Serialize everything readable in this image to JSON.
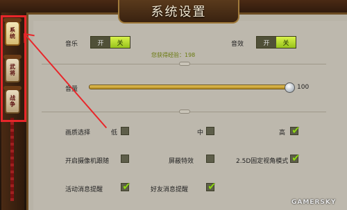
{
  "header": {
    "title": "系统设置"
  },
  "tabs": [
    {
      "label": "系统",
      "active": true
    },
    {
      "label": "武将",
      "active": false
    },
    {
      "label": "战争",
      "active": false
    }
  ],
  "audio": {
    "music_label": "音乐",
    "music_on": "开",
    "music_off": "关",
    "sfx_label": "音效",
    "sfx_on": "开",
    "sfx_off": "关"
  },
  "exp_text": "您获得经验：198",
  "volume": {
    "label": "音量",
    "value": "100",
    "level": 100
  },
  "quality": {
    "label": "画质选择",
    "low": "低",
    "mid": "中",
    "high": "高"
  },
  "options": {
    "camera_follow": "开启摄像机跟随",
    "mask_effect": "屏蔽特效",
    "fixed_angle": "2.5D固定视角模式",
    "activity_notice": "活动消息提醒",
    "friend_notice": "好友消息提醒"
  },
  "checked": {
    "quality_low": false,
    "quality_mid": false,
    "quality_high": true,
    "camera_follow": false,
    "mask_effect": false,
    "fixed_angle": true,
    "activity_notice": true,
    "friend_notice": true
  },
  "colors": {
    "accent": "#9acb1d",
    "highlight": "#e8262a",
    "panel": "#bdb8ad"
  },
  "watermark": "GAMERSKY"
}
